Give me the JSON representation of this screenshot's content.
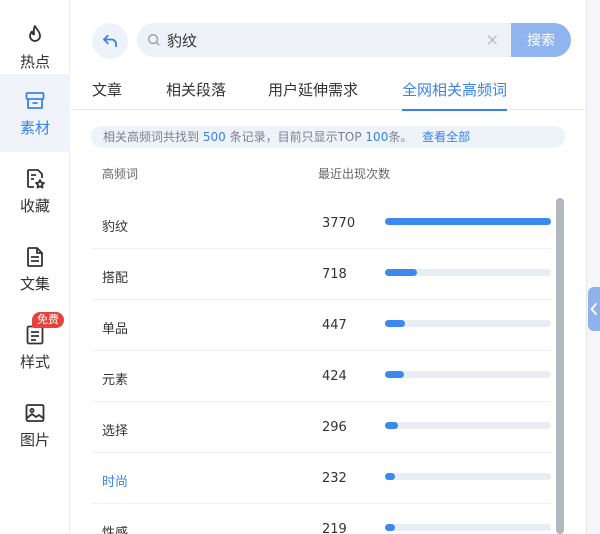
{
  "sidebar": {
    "items": [
      {
        "label": "热点",
        "icon": "flame-icon"
      },
      {
        "label": "素材",
        "icon": "archive-box-icon"
      },
      {
        "label": "收藏",
        "icon": "star-document-icon"
      },
      {
        "label": "文集",
        "icon": "document-icon"
      },
      {
        "label": "样式",
        "icon": "list-document-icon",
        "badge": "免费"
      },
      {
        "label": "图片",
        "icon": "image-icon"
      }
    ],
    "active_index": 1
  },
  "search": {
    "value": "豹纹",
    "button_label": "搜索"
  },
  "tabs": [
    {
      "label": "文章"
    },
    {
      "label": "相关段落"
    },
    {
      "label": "用户延伸需求"
    },
    {
      "label": "全网相关高频词"
    }
  ],
  "active_tab": 3,
  "info": {
    "prefix": "相关高频词共找到",
    "total": "500",
    "middle": "条记录，目前只显示TOP",
    "top": "100",
    "suffix": "条。",
    "link": "查看全部"
  },
  "table": {
    "headers": {
      "word": "高频词",
      "count": "最近出现次数"
    },
    "max_count": 3770,
    "rows": [
      {
        "word": "豹纹",
        "count": 3770
      },
      {
        "word": "搭配",
        "count": 718
      },
      {
        "word": "单品",
        "count": 447
      },
      {
        "word": "元素",
        "count": 424
      },
      {
        "word": "选择",
        "count": 296
      },
      {
        "word": "时尚",
        "count": 232
      },
      {
        "word": "性感",
        "count": 219
      }
    ],
    "hover_row": 5
  },
  "colors": {
    "accent": "#3b82e8",
    "bar": "#3b88ef",
    "badge": "#e8413c",
    "search_button": "#8fb4ef"
  }
}
